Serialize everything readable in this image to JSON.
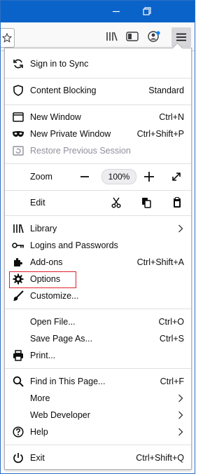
{
  "colors": {
    "titlebar": "#0a63c9",
    "highlight": "#e0202a",
    "menu_bg": "#ffffff"
  },
  "window_controls": {
    "minimize": "minimize-icon",
    "restore": "restore-icon"
  },
  "toolbar": {
    "menu_button": "hamburger-icon"
  },
  "menu": {
    "sync": {
      "label": "Sign in to Sync",
      "icon": "sync-icon"
    },
    "content_blocking": {
      "label": "Content Blocking",
      "value": "Standard",
      "icon": "shield-icon"
    },
    "new_window": {
      "label": "New Window",
      "shortcut": "Ctrl+N",
      "icon": "new-window-icon"
    },
    "new_private": {
      "label": "New Private Window",
      "shortcut": "Ctrl+Shift+P",
      "icon": "mask-icon"
    },
    "restore_session": {
      "label": "Restore Previous Session",
      "icon": "restore-session-icon"
    },
    "zoom": {
      "label": "Zoom",
      "minus": "−",
      "value": "100%",
      "plus": "+"
    },
    "edit": {
      "label": "Edit"
    },
    "library": {
      "label": "Library"
    },
    "logins": {
      "label": "Logins and Passwords"
    },
    "addons": {
      "label": "Add-ons",
      "shortcut": "Ctrl+Shift+A"
    },
    "options": {
      "label": "Options"
    },
    "customize": {
      "label": "Customize..."
    },
    "open_file": {
      "label": "Open File...",
      "shortcut": "Ctrl+O"
    },
    "save_page": {
      "label": "Save Page As...",
      "shortcut": "Ctrl+S"
    },
    "print": {
      "label": "Print..."
    },
    "find": {
      "label": "Find in This Page...",
      "shortcut": "Ctrl+F"
    },
    "more": {
      "label": "More"
    },
    "web_developer": {
      "label": "Web Developer"
    },
    "help": {
      "label": "Help"
    },
    "exit": {
      "label": "Exit",
      "shortcut": "Ctrl+Shift+Q"
    }
  }
}
